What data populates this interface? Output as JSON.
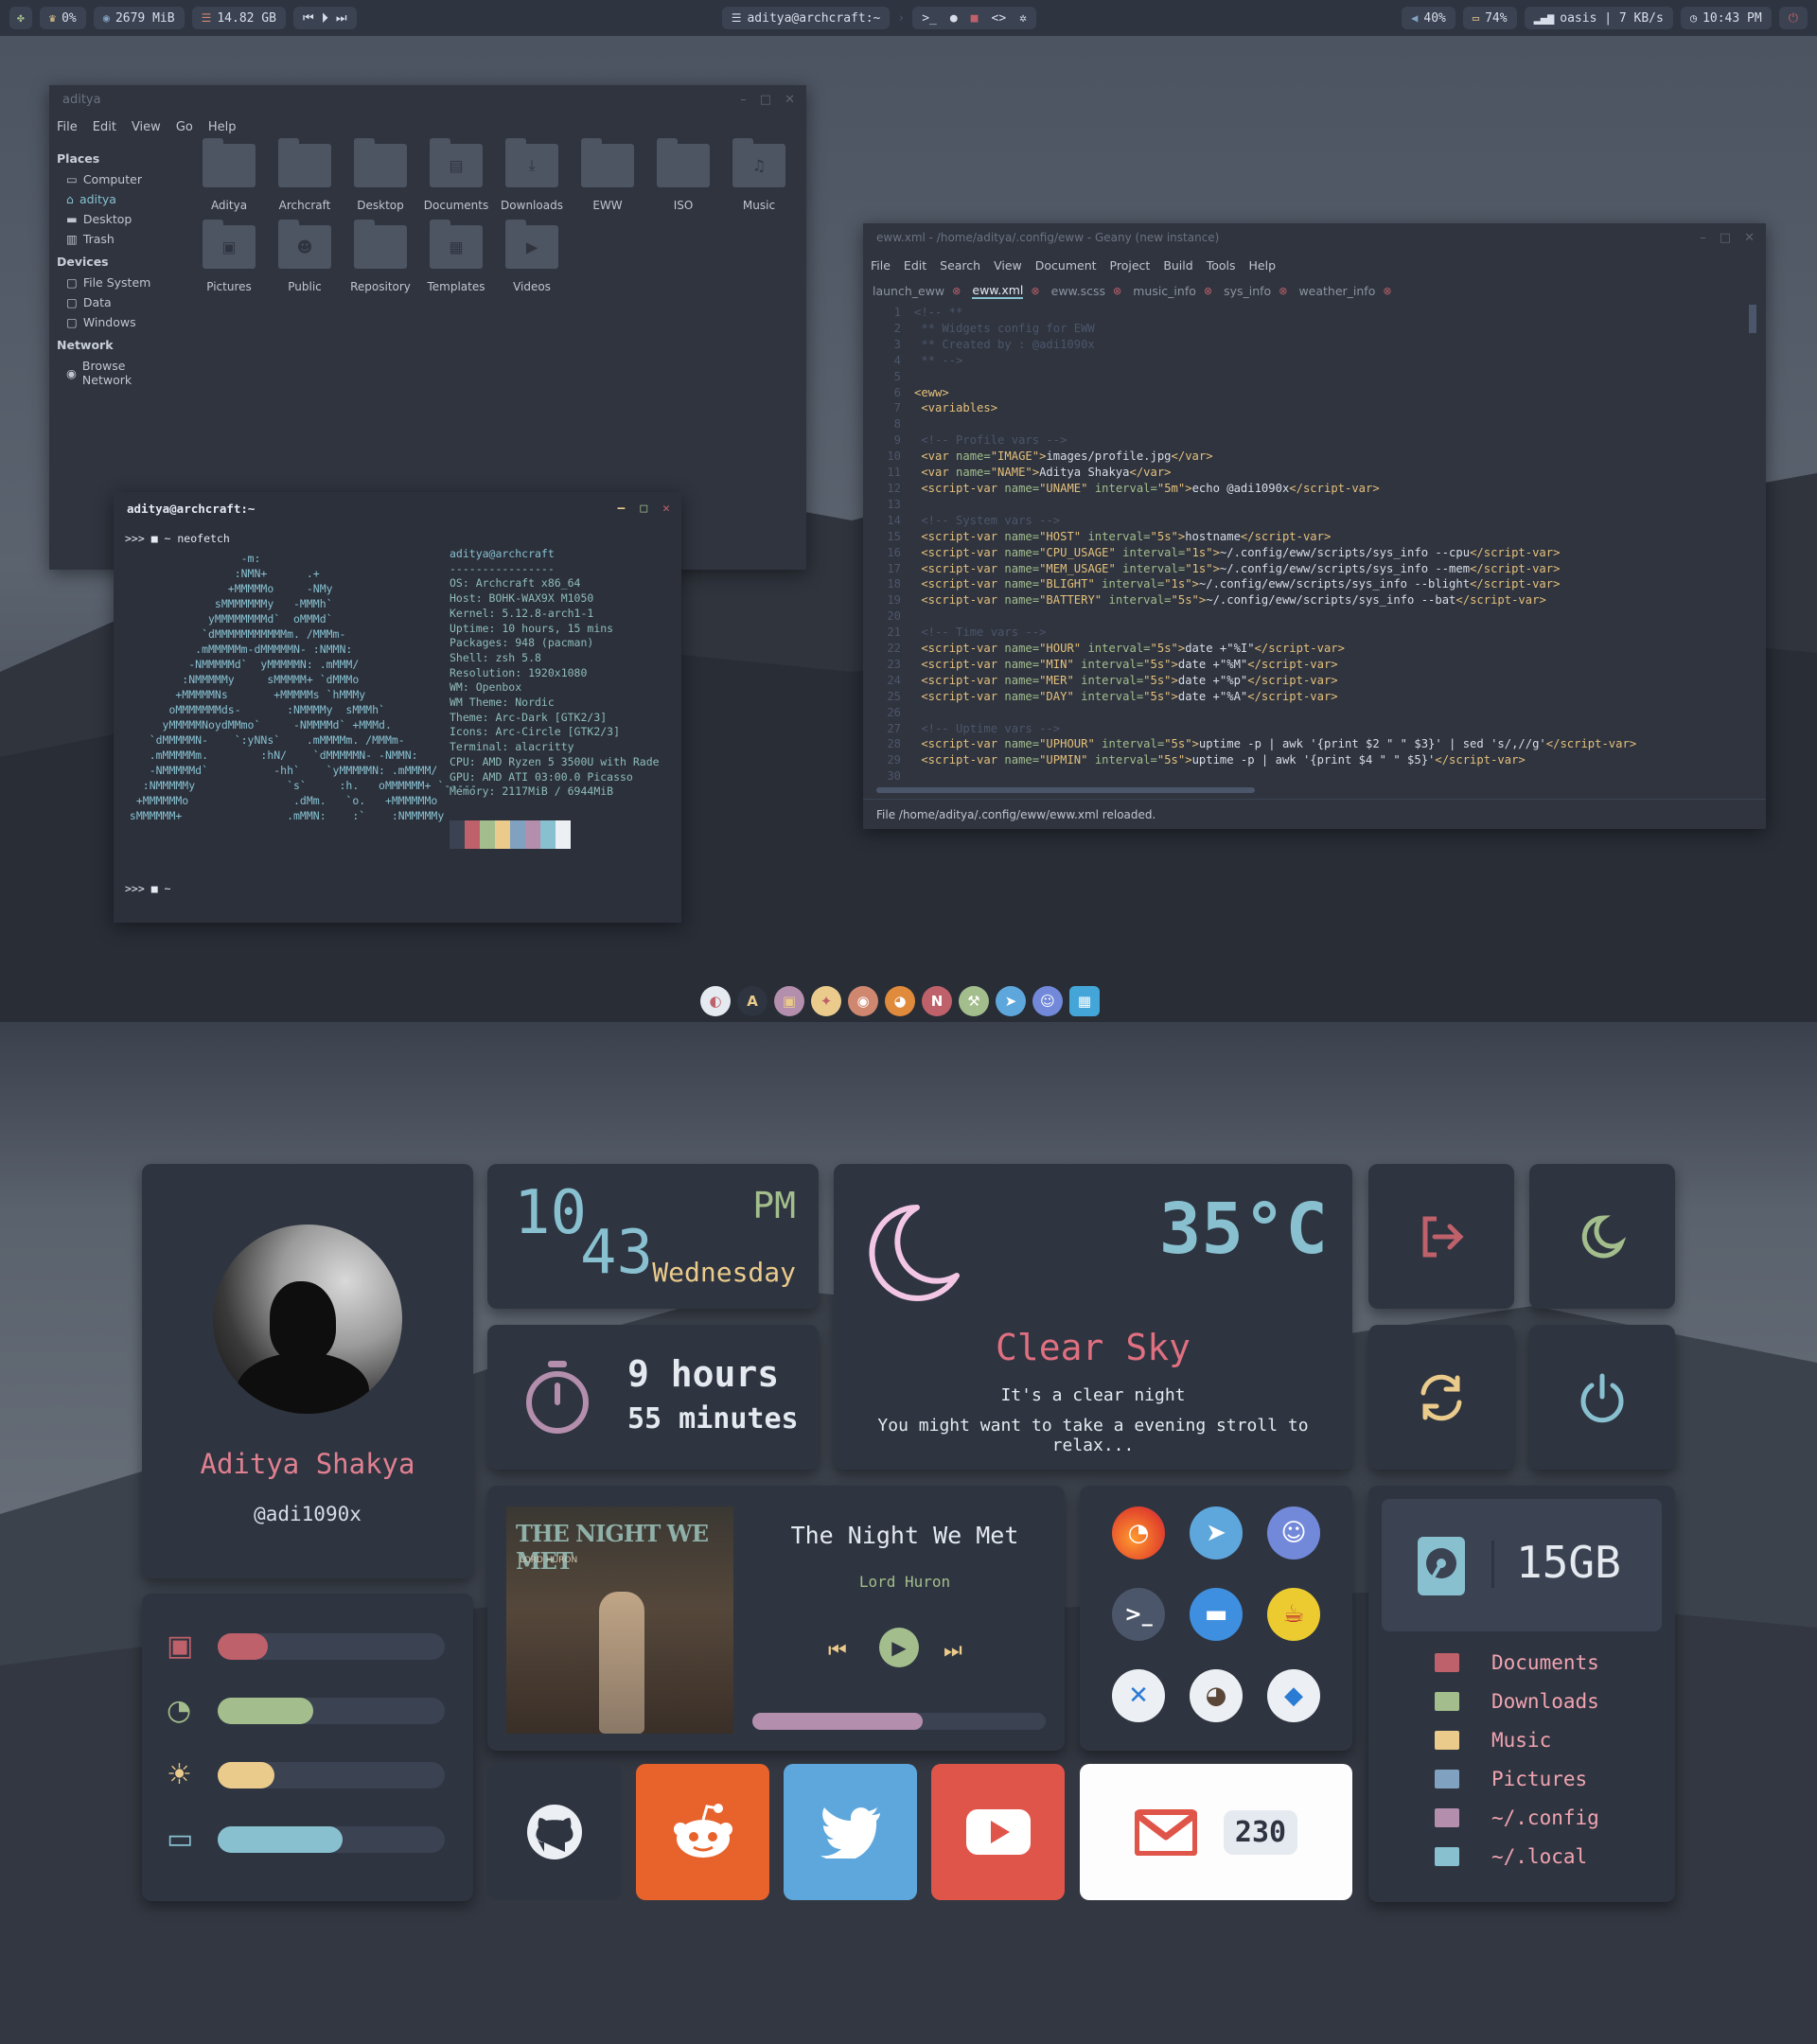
{
  "topbar": {
    "cpu": "0%",
    "ram": "2679 MiB",
    "disk": "14.82 GB",
    "title": "aditya@archcraft:~",
    "volume": "40%",
    "battery": "74%",
    "network": "oasis | 7 KB/s",
    "clock": "10:43 PM"
  },
  "filemanager": {
    "title": "aditya",
    "menu": [
      "File",
      "Edit",
      "View",
      "Go",
      "Help"
    ],
    "places_label": "Places",
    "places": [
      "Computer",
      "aditya",
      "Desktop",
      "Trash"
    ],
    "devices_label": "Devices",
    "devices": [
      "File System",
      "Data",
      "Windows"
    ],
    "network_label": "Network",
    "network": [
      "Browse Network"
    ],
    "folders": [
      "Aditya",
      "Archcraft",
      "Desktop",
      "Documents",
      "Downloads",
      "EWW",
      "ISO",
      "Music",
      "Pictures",
      "Public",
      "Repository",
      "Templates",
      "Videos"
    ]
  },
  "terminal": {
    "title": "aditya@archcraft:~",
    "prompt": ">>> ■ ~ neofetch",
    "prompt2": ">>> ■ ~",
    "user": "aditya@archcraft",
    "sep": "----------------",
    "info": [
      "OS: Archcraft x86_64",
      "Host: BOHK-WAX9X M1050",
      "Kernel: 5.12.8-arch1-1",
      "Uptime: 10 hours, 15 mins",
      "Packages: 948 (pacman)",
      "Shell: zsh 5.8",
      "Resolution: 1920x1080",
      "WM: Openbox",
      "WM Theme: Nordic",
      "Theme: Arc-Dark [GTK2/3]",
      "Icons: Arc-Circle [GTK2/3]",
      "Terminal: alacritty",
      "CPU: AMD Ryzen 5 3500U with Rade",
      "GPU: AMD ATI 03:00.0 Picasso",
      "Memory: 2117MiB / 6944MiB"
    ],
    "palette": [
      "#3b4252",
      "#bf616a",
      "#a3be8c",
      "#ebcb8b",
      "#81a1c1",
      "#b48ead",
      "#88c0d0",
      "#eceff4"
    ]
  },
  "geany": {
    "title": "eww.xml - /home/aditya/.config/eww - Geany (new instance)",
    "menu": [
      "File",
      "Edit",
      "Search",
      "View",
      "Document",
      "Project",
      "Build",
      "Tools",
      "Help"
    ],
    "tabs": [
      "launch_eww",
      "eww.xml",
      "eww.scss",
      "music_info",
      "sys_info",
      "weather_info"
    ],
    "status": "File /home/aditya/.config/eww/eww.xml reloaded."
  },
  "dock": {
    "icons": [
      "settings-icon",
      "archcraft-icon",
      "files-icon",
      "geany-icon",
      "firefox-icon",
      "blender-icon",
      "nvim-icon",
      "tools-icon",
      "telegram-icon",
      "discord-icon",
      "screenshot-icon"
    ]
  },
  "profile": {
    "name": "Aditya Shakya",
    "handle": "@adi1090x"
  },
  "clock": {
    "hour": "10",
    "minute": "43",
    "ampm": "PM",
    "day": "Wednesday"
  },
  "uptime": {
    "hours": "9 hours",
    "minutes": "55 minutes"
  },
  "weather": {
    "temp": "35°C",
    "condition": "Clear Sky",
    "line1": "It's a clear night",
    "line2": "You might want to take a evening stroll to relax..."
  },
  "sysbars": [
    {
      "name": "cpu",
      "value": 0.22,
      "color": "#bf616a"
    },
    {
      "name": "memory",
      "value": 0.42,
      "color": "#a3be8c"
    },
    {
      "name": "brightness",
      "value": 0.25,
      "color": "#ebcb8b"
    },
    {
      "name": "battery",
      "value": 0.55,
      "color": "#88c0d0"
    }
  ],
  "music": {
    "song": "The Night We Met",
    "artist": "Lord Huron",
    "cover_title": "THE NIGHT WE MET",
    "cover_artist": "LORD HURON",
    "progress": 0.58
  },
  "mail": {
    "count": "230"
  },
  "disk": {
    "free": "15GB"
  },
  "folders": [
    {
      "label": "Documents",
      "color": "#bf616a"
    },
    {
      "label": "Downloads",
      "color": "#a3be8c"
    },
    {
      "label": "Music",
      "color": "#ebcb8b"
    },
    {
      "label": "Pictures",
      "color": "#81a1c1"
    },
    {
      "label": "~/.config",
      "color": "#b48ead"
    },
    {
      "label": "~/.local",
      "color": "#88c0d0"
    }
  ],
  "colors": {
    "bg": "#2e3440",
    "red": "#bf616a",
    "green": "#a3be8c",
    "yellow": "#ebcb8b",
    "blue": "#88c0d0",
    "purple": "#b48ead",
    "pink": "#f0a4b0"
  }
}
